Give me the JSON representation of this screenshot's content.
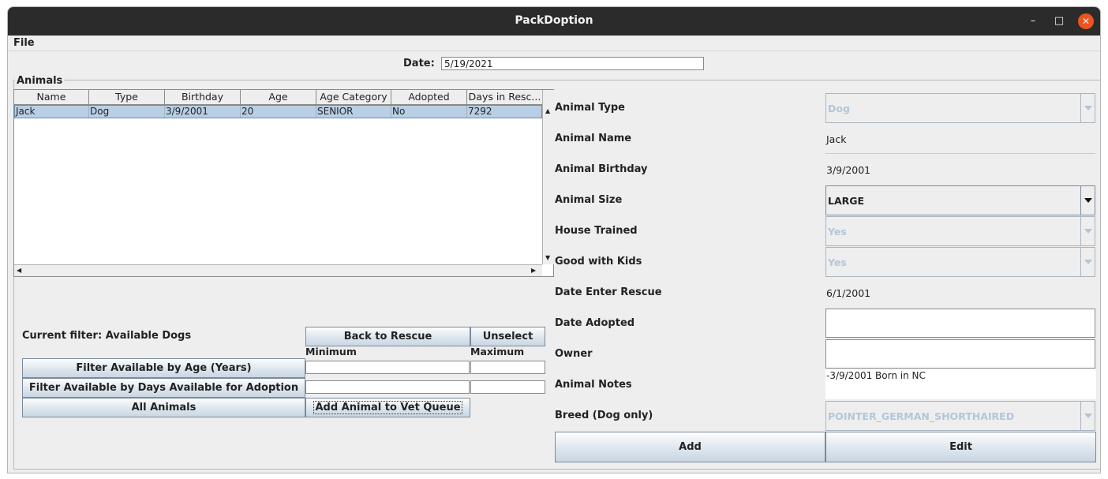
{
  "window": {
    "title": "PackDoption"
  },
  "menu": {
    "file": "File"
  },
  "date": {
    "label": "Date:",
    "value": "5/19/2021"
  },
  "animals_group": {
    "title": "Animals"
  },
  "table": {
    "columns": [
      "Name",
      "Type",
      "Birthday",
      "Age",
      "Age Category",
      "Adopted",
      "Days in Resc..."
    ],
    "rows": [
      [
        "Jack",
        "Dog",
        "3/9/2001",
        "20",
        "SENIOR",
        "No",
        "7292"
      ]
    ]
  },
  "filter": {
    "current_label": "Current filter: Available Dogs",
    "back_to_rescue": "Back to Rescue",
    "unselect": "Unselect",
    "minimum": "Minimum",
    "maximum": "Maximum",
    "by_age": "Filter Available by Age (Years)",
    "by_days": "Filter Available by Days Available for Adoption",
    "all_animals": "All Animals",
    "add_vet_queue": "Add Animal to Vet Queue"
  },
  "form": {
    "animal_type": {
      "label": "Animal Type",
      "value": "Dog"
    },
    "animal_name": {
      "label": "Animal Name",
      "value": "Jack"
    },
    "animal_birthday": {
      "label": "Animal Birthday",
      "value": "3/9/2001"
    },
    "animal_size": {
      "label": "Animal Size",
      "value": "LARGE"
    },
    "house_trained": {
      "label": "House Trained",
      "value": "Yes"
    },
    "good_with_kids": {
      "label": "Good with Kids",
      "value": "Yes"
    },
    "date_enter_rescue": {
      "label": "Date Enter Rescue",
      "value": "6/1/2001"
    },
    "date_adopted": {
      "label": "Date Adopted",
      "value": ""
    },
    "owner": {
      "label": "Owner",
      "value": ""
    },
    "animal_notes": {
      "label": "Animal Notes",
      "value": "-3/9/2001 Born in NC"
    },
    "breed": {
      "label": "Breed (Dog only)",
      "value": "POINTER_GERMAN_SHORTHAIRED"
    },
    "add": "Add",
    "edit": "Edit"
  }
}
